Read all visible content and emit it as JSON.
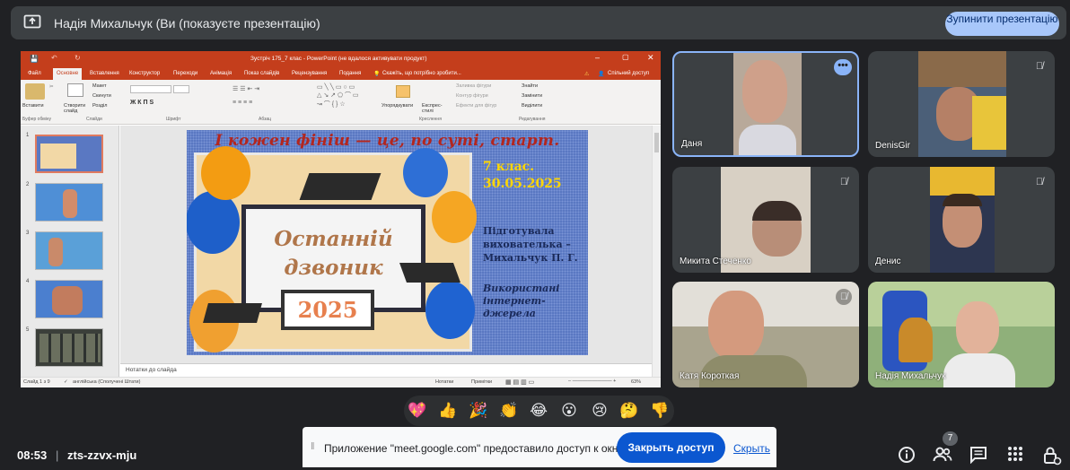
{
  "topbar": {
    "title": "Надія Михальчук (Ви (показуєте презентацію)",
    "stop_button": "Зупинити презентацію"
  },
  "ppt": {
    "window_title": "Зустріч 175_7 клас - PowerPoint (не вдалося активувати продукт)",
    "menu": [
      "Файл",
      "Основне",
      "Вставлення",
      "Конструктор",
      "Переходи",
      "Анімація",
      "Показ слайдів",
      "Рецензування",
      "Подання"
    ],
    "tell_me": "Скажіть, що потрібно зробити...",
    "share": "Спільний доступ",
    "ribbon": {
      "paste": "Вставити",
      "new_slide": "Створити слайд",
      "layout": "Макет",
      "reset": "Скинути",
      "section": "Розділ",
      "find": "Знайти",
      "replace": "Замінити",
      "select": "Виділити",
      "arrange": "Упорядкувати",
      "quick_styles": "Експрес-стилі",
      "fill": "Заливка фігури",
      "outline": "Контур фігури",
      "effects": "Ефекти для фігур",
      "groups": [
        "Буфер обміну",
        "Слайди",
        "Шрифт",
        "Абзац",
        "Креслення",
        "Редагування"
      ]
    },
    "thumb_numbers": [
      "1",
      "2",
      "3",
      "4",
      "5"
    ],
    "notes_placeholder": "Нотатки до слайда",
    "status_left": "Слайд 1 з 9",
    "status_lang": "англійська (Сполучені Штати)",
    "status_notes": "Нотатки",
    "status_comments": "Примітки",
    "zoom": "63%"
  },
  "slide": {
    "banner": "І кожен фініш — це, по суті, старт.",
    "title_line1": "Останній",
    "title_line2": "дзвоник",
    "year": "2025",
    "class": "7 клас.",
    "date": "30.05.2025",
    "prep_line1": "Підготувала",
    "prep_line2": "вихователька –",
    "prep_line3": "Михальчук П. Г.",
    "src_line1": "Використані",
    "src_line2": "інтернет-джерела"
  },
  "participants": [
    {
      "name": "Даня",
      "muted": false
    },
    {
      "name": "DenisGir",
      "muted": true
    },
    {
      "name": "Микита Стеченко",
      "muted": true
    },
    {
      "name": "Денис",
      "muted": true
    },
    {
      "name": "Катя Короткая",
      "muted": true
    },
    {
      "name": "Надія Михальчук",
      "muted": false
    }
  ],
  "reactions": [
    "💖",
    "👍",
    "🎉",
    "👏",
    "😂",
    "😮",
    "😢",
    "🤔",
    "👎"
  ],
  "bottom": {
    "time": "08:53",
    "separator": "|",
    "meeting_code": "zts-zzvx-mju",
    "people_count": "7"
  },
  "notice": {
    "text": "Приложение \"meet.google.com\" предоставило доступ к окну.",
    "close_button": "Закрыть доступ",
    "hide_link": "Скрыть"
  },
  "colors": {
    "background": "#202124",
    "accent": "#8ab4f8",
    "stop_button": "#a8c7fa",
    "ppt_red": "#c43e1c",
    "notice_button": "#0b57d0"
  }
}
